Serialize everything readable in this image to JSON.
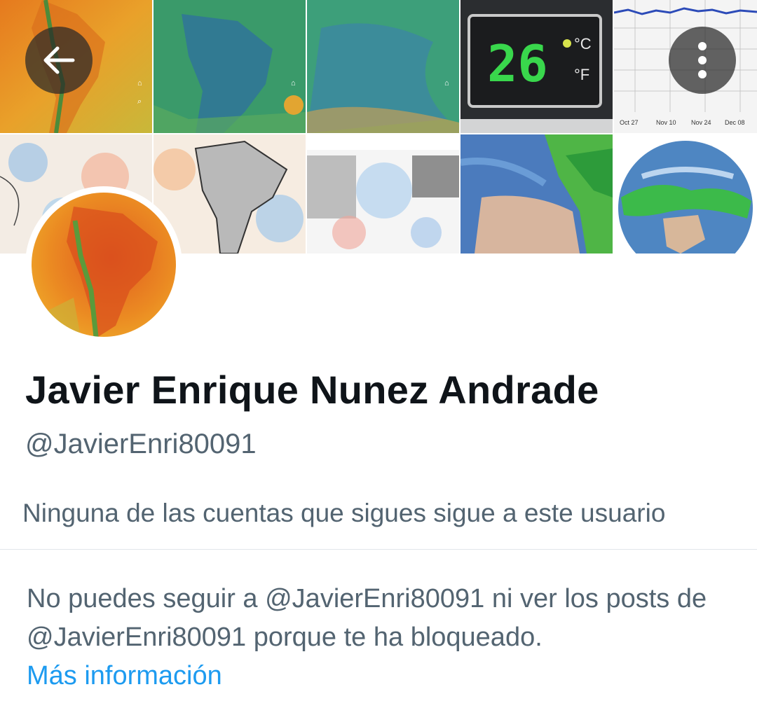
{
  "header": {
    "back_icon": "arrow-left-icon",
    "more_icon": "more-vertical-icon"
  },
  "banner": {
    "thermometer_value": "26",
    "unit_c": "°C",
    "unit_f": "°F",
    "graph_dates": [
      "Oct 27",
      "Nov 10",
      "Nov 24",
      "Dec 08"
    ]
  },
  "profile": {
    "display_name": "Javier Enrique Nunez Andrade",
    "handle": "@JavierEnri80091",
    "followers_note": "Ninguna de las cuentas que sigues sigue a este usuario"
  },
  "blocked": {
    "message": "No puedes seguir a @JavierEnri80091 ni ver los posts de @JavierEnri80091 porque te ha bloqueado.",
    "learn_more": "Más información"
  },
  "colors": {
    "text_primary": "#0f1419",
    "text_secondary": "#536471",
    "link": "#1d9bf0",
    "divider": "#e1e6ea"
  }
}
